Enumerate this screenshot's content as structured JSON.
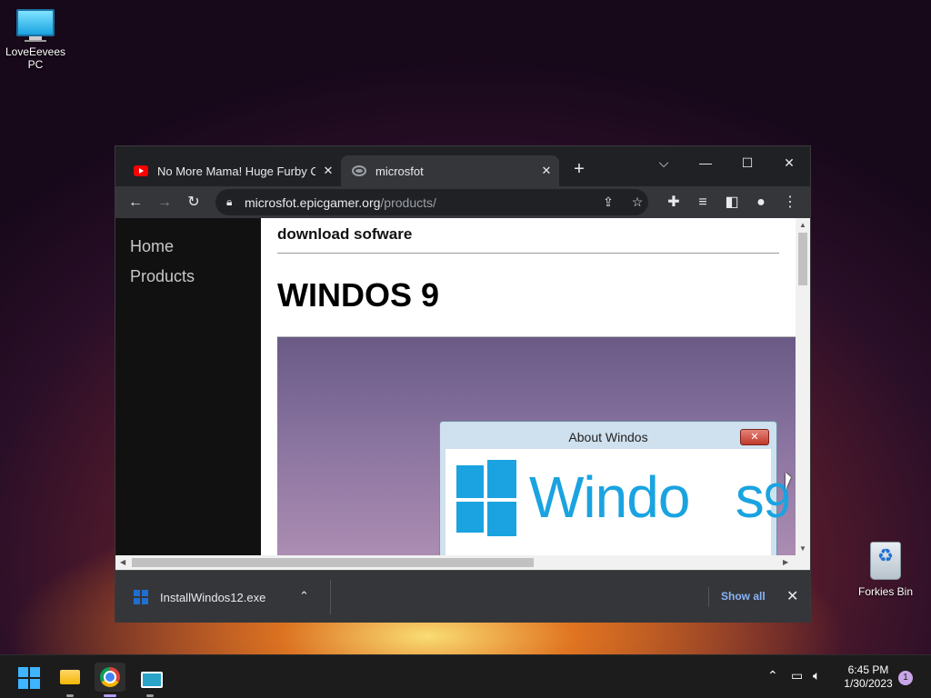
{
  "desktop": {
    "pc_icon_label": "LoveEevees PC",
    "bin_icon_label": "Forkies Bin"
  },
  "browser": {
    "tabs": [
      {
        "title": "No More Mama! Huge Furby Co",
        "favicon": "youtube-icon"
      },
      {
        "title": "microsfot",
        "favicon": "globe-icon"
      }
    ],
    "address": {
      "host": "microsfot.epicgamer.org",
      "path": "/products/"
    }
  },
  "page": {
    "nav": [
      "Home",
      "Products"
    ],
    "subtitle": "download sofware",
    "heading": "WINDOS 9",
    "about_dialog": {
      "title": "About Windos",
      "brand_text": "Windo   s",
      "brand_number": "9"
    }
  },
  "download_bar": {
    "filename": "InstallWindos12.exe",
    "show_all": "Show all"
  },
  "taskbar": {
    "time": "6:45 PM",
    "date": "1/30/2023",
    "notification_count": "1"
  },
  "colors": {
    "accent_blue": "#1aa3e0",
    "link_blue": "#8ab4f8"
  }
}
